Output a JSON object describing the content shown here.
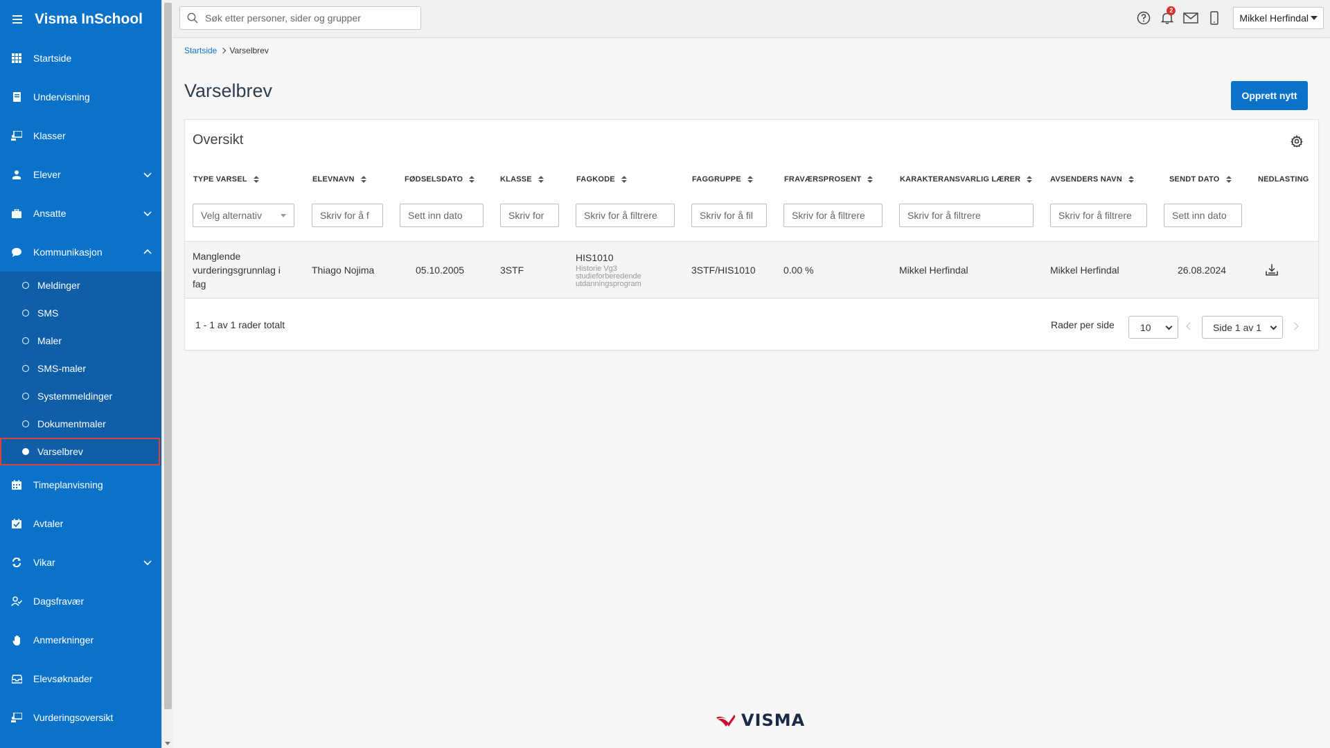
{
  "app": {
    "title": "Visma InSchool"
  },
  "sidebar": {
    "items": [
      {
        "label": "Startside"
      },
      {
        "label": "Undervisning"
      },
      {
        "label": "Klasser"
      },
      {
        "label": "Elever"
      },
      {
        "label": "Ansatte"
      },
      {
        "label": "Kommunikasjon"
      },
      {
        "label": "Timeplanvisning"
      },
      {
        "label": "Avtaler"
      },
      {
        "label": "Vikar"
      },
      {
        "label": "Dagsfravær"
      },
      {
        "label": "Anmerkninger"
      },
      {
        "label": "Elevsøknader"
      },
      {
        "label": "Vurderingsoversikt"
      }
    ],
    "sub_items": [
      {
        "label": "Meldinger"
      },
      {
        "label": "SMS"
      },
      {
        "label": "Maler"
      },
      {
        "label": "SMS-maler"
      },
      {
        "label": "Systemmeldinger"
      },
      {
        "label": "Dokumentmaler"
      },
      {
        "label": "Varselbrev"
      }
    ],
    "active_sub": "Varselbrev",
    "colors": {
      "background": "#0a73c9",
      "group_background": "#0e5ea8",
      "highlight_border": "#e0413a"
    }
  },
  "topbar": {
    "search_placeholder": "Søk etter personer, sider og grupper",
    "notification_count": "2",
    "user_name": "Mikkel Herfindal"
  },
  "breadcrumb": {
    "home": "Startside",
    "current": "Varselbrev"
  },
  "page": {
    "title": "Varselbrev",
    "create_button": "Opprett nytt"
  },
  "card": {
    "title": "Oversikt",
    "columns": [
      {
        "label": "TYPE VARSEL",
        "filter": "Velg alternativ"
      },
      {
        "label": "ELEVNAVN",
        "filter": "Skriv for å f"
      },
      {
        "label": "FØDSELSDATO",
        "filter": "Sett inn dato"
      },
      {
        "label": "KLASSE",
        "filter": "Skriv for"
      },
      {
        "label": "FAGKODE",
        "filter": "Skriv for å filtrere"
      },
      {
        "label": "FAGGRUPPE",
        "filter": "Skriv for å fil"
      },
      {
        "label": "FRAVÆRSPROSENT",
        "filter": "Skriv for å filtrere"
      },
      {
        "label": "KARAKTERANSVARLIG LÆRER",
        "filter": "Skriv for å filtrere"
      },
      {
        "label": "AVSENDERS NAVN",
        "filter": "Skriv for å filtrere"
      },
      {
        "label": "SENDT DATO",
        "filter": "Sett inn dato"
      },
      {
        "label": "NEDLASTING",
        "filter": ""
      }
    ],
    "rows": [
      {
        "type_varsel": "Manglende vurderingsgrunnlag i fag",
        "elevnavn": "Thiago Nojima",
        "fodselsdato": "05.10.2005",
        "klasse": "3STF",
        "fagkode": "HIS1010",
        "fagkode_desc": "Historie Vg3 studieforberedende utdanningsprogram",
        "faggruppe": "3STF/HIS1010",
        "fravaersprosent": "0.00 %",
        "karakteransvarlig": "Mikkel Herfindal",
        "avsender": "Mikkel Herfindal",
        "sendt_dato": "26.08.2024"
      }
    ],
    "footer": {
      "count_text": "1 - 1 av 1 rader totalt",
      "rows_per_page_label": "Rader per side",
      "rows_per_page_value": "10",
      "page_text": "Side 1 av 1"
    }
  },
  "footer_logo": "VISMA"
}
